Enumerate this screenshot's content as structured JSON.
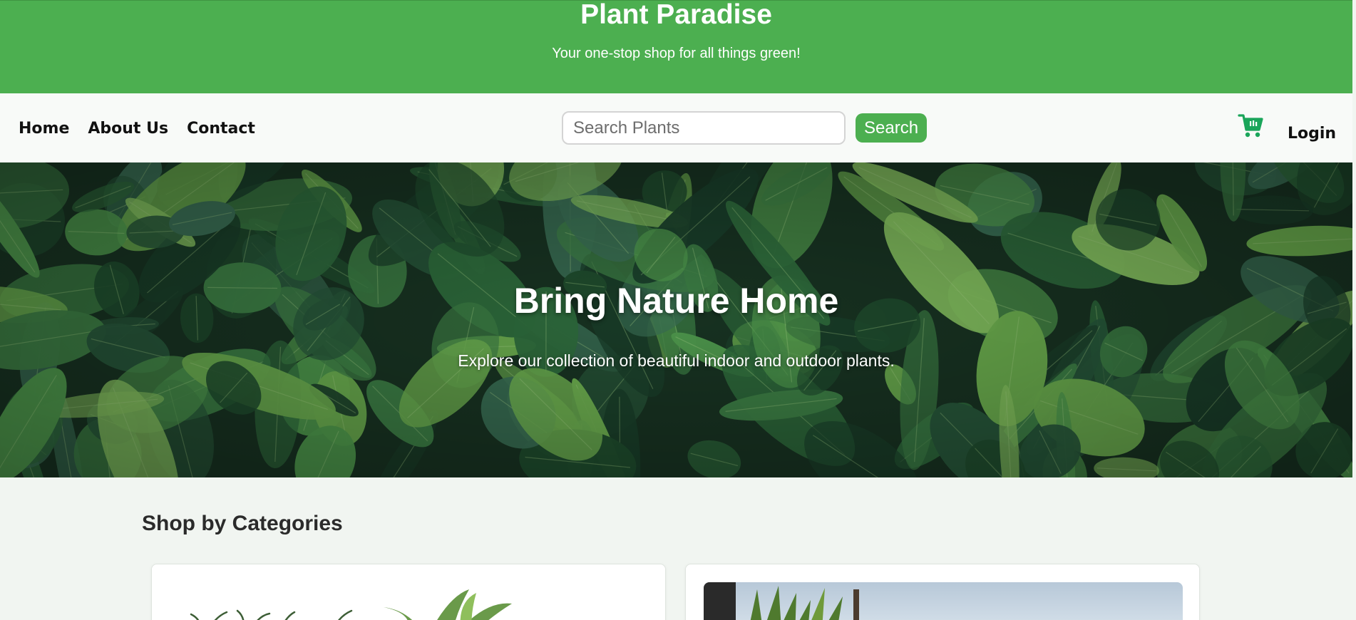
{
  "header": {
    "title": "Plant Paradise",
    "tagline": "Your one-stop shop for all things green!"
  },
  "nav": {
    "links": [
      "Home",
      "About Us",
      "Contact"
    ],
    "search_placeholder": "Search Plants",
    "search_value": "",
    "search_button": "Search",
    "cart_icon": "shopping-cart-icon",
    "login_label": "Login"
  },
  "hero": {
    "title": "Bring Nature Home",
    "subtitle": "Explore our collection of beautiful indoor and outdoor plants."
  },
  "categories": {
    "title": "Shop by Categories"
  },
  "colors": {
    "brand_green": "#4caf50",
    "nav_background": "#f8faf8",
    "page_background": "#f1f5f1"
  }
}
